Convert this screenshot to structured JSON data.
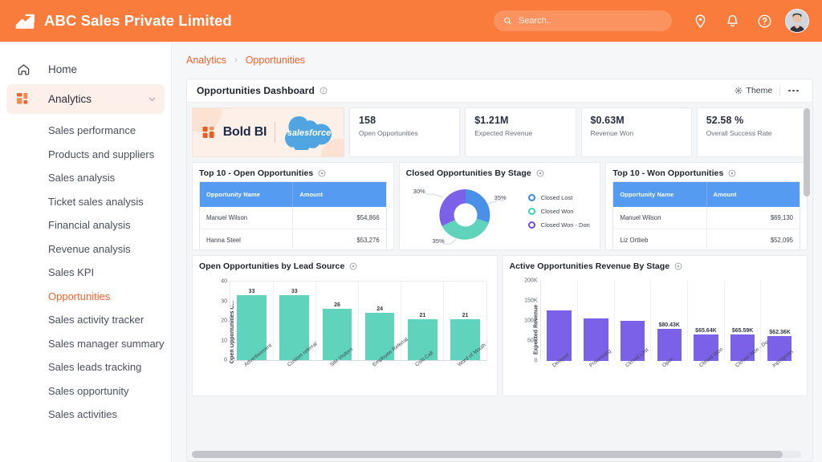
{
  "topbar": {
    "brand_title": "ABC Sales Private Limited",
    "logo_icon": "trend-up-icon",
    "search_placeholder": "Search..",
    "search_value": "",
    "icons": [
      "location-pin-icon",
      "bell-icon",
      "help-circle-icon"
    ],
    "avatar": "user-avatar",
    "bg_color": "#F97C3C"
  },
  "sidebar": {
    "items": [
      {
        "label": "Home",
        "icon": "home-icon",
        "active": false
      },
      {
        "label": "Analytics",
        "icon": "grid-icon",
        "active": true,
        "expandable": true
      }
    ],
    "sub_items": [
      {
        "label": "Sales performance",
        "current": false
      },
      {
        "label": "Products and suppliers",
        "current": false
      },
      {
        "label": "Sales analysis",
        "current": false
      },
      {
        "label": "Ticket sales analysis",
        "current": false
      },
      {
        "label": "Financial analysis",
        "current": false
      },
      {
        "label": "Revenue analysis",
        "current": false
      },
      {
        "label": "Sales KPI",
        "current": false
      },
      {
        "label": "Opportunities",
        "current": true
      },
      {
        "label": "Sales activity tracker",
        "current": false
      },
      {
        "label": "Sales manager summary",
        "current": false
      },
      {
        "label": "Sales leads tracking",
        "current": false
      },
      {
        "label": "Sales opportunity",
        "current": false
      },
      {
        "label": "Sales activities",
        "current": false
      }
    ],
    "accent_color": "#F2622A"
  },
  "breadcrumb": {
    "items": [
      "Analytics",
      "Opportunities"
    ],
    "separator": "›"
  },
  "panel": {
    "title": "Opportunities Dashboard",
    "info_icon": "info-circle-icon",
    "theme_label": "Theme",
    "theme_icon": "palette-icon",
    "more_icon": "more-horizontal-icon"
  },
  "logo_card": {
    "bold_bi": "Bold BI",
    "salesforce": "salesforce"
  },
  "kpis": [
    {
      "value": "158",
      "label": "Open Opportunities"
    },
    {
      "value": "$1.21M",
      "label": "Expected Revenue"
    },
    {
      "value": "$0.63M",
      "label": "Revenue Won"
    },
    {
      "value": "52.58 %",
      "label": "Overall Success Rate"
    }
  ],
  "table_open": {
    "title": "Top 10 - Open Opportunities",
    "columns": [
      "Opportunity Name",
      "Amount"
    ],
    "rows": [
      {
        "name": "Manuel Wilson",
        "amount": "$54,866"
      },
      {
        "name": "Hanna Steel",
        "amount": "$53,276"
      }
    ]
  },
  "table_won": {
    "title": "Top 10 - Won Opportunities",
    "columns": [
      "Opportunity Name",
      "Amount"
    ],
    "rows": [
      {
        "name": "Manuel Wilson",
        "amount": "$69,130"
      },
      {
        "name": "Liz Ortlieb",
        "amount": "$52,095"
      }
    ]
  },
  "donut": {
    "title": "Closed Opportunities By Stage"
  },
  "bar_left": {
    "title": "Open Opportunities by Lead Source"
  },
  "bar_right": {
    "title": "Active Opportunities Revenue By Stage"
  },
  "chart_data": [
    {
      "type": "pie",
      "title": "Closed Opportunities By Stage",
      "legend_position": "right",
      "labels": [
        "Closed Lost",
        "Closed Won",
        "Closed Won - Don"
      ],
      "values": [
        35,
        35,
        30
      ],
      "value_labels": [
        "35%",
        "35%",
        "30%"
      ],
      "colors": [
        "#4A90E8",
        "#5FD3BC",
        "#7B61E8"
      ],
      "donut": true
    },
    {
      "type": "bar",
      "title": "Open Opportunities by Lead Source",
      "categories": [
        "Advertisement",
        "Custom referral",
        "Site Visitors",
        "Employee Referral",
        "Cold Call",
        "Word of Mouth"
      ],
      "values": [
        33,
        33,
        26,
        24,
        21,
        21
      ],
      "value_labels": [
        "33",
        "33",
        "26",
        "24",
        "21",
        "21"
      ],
      "xlabel": "",
      "ylabel": "Open Opportunities C...",
      "yticks": [
        "0",
        "10",
        "20",
        "30",
        "40"
      ],
      "ylim": [
        0,
        40
      ],
      "grid": false,
      "color": "#5FD3BC"
    },
    {
      "type": "bar",
      "title": "Active Opportunities Revenue By Stage",
      "categories": [
        "Delayed",
        "Processing",
        "Closed Lost",
        "Open",
        "Closed Won",
        "Closed Won - Done",
        "Inprogress"
      ],
      "values": [
        127000,
        106000,
        101000,
        80430,
        65640,
        65590,
        62360
      ],
      "value_labels": [
        "",
        "",
        "",
        "$80.43K",
        "$65.64K",
        "$65.59K",
        "$62.36K"
      ],
      "xlabel": "",
      "ylabel": "Expected Revenue",
      "yticks": [
        "0",
        "50K",
        "100K",
        "150K",
        "200K"
      ],
      "ylim": [
        0,
        200000
      ],
      "grid": false,
      "color": "#7B61E8"
    }
  ]
}
